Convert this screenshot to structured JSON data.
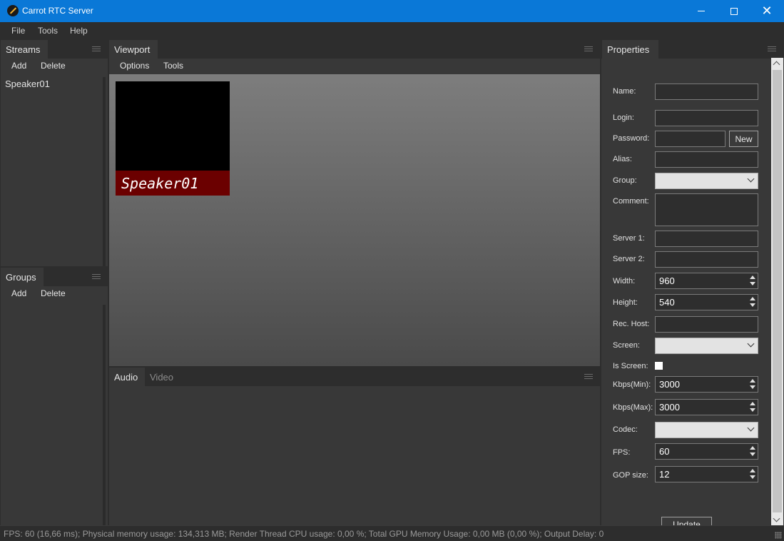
{
  "window": {
    "title": "Carrot RTC Server"
  },
  "menu": [
    "File",
    "Tools",
    "Help"
  ],
  "streams_panel": {
    "tab": "Streams",
    "toolbar": [
      "Add",
      "Delete"
    ],
    "items": [
      "Speaker01"
    ]
  },
  "groups_panel": {
    "tab": "Groups",
    "toolbar": [
      "Add",
      "Delete"
    ]
  },
  "viewport_panel": {
    "tab": "Viewport",
    "toolbar": [
      "Options",
      "Tools"
    ],
    "tile_label": "Speaker01"
  },
  "media_panel": {
    "tabs": [
      "Audio",
      "Video"
    ]
  },
  "properties": {
    "tab": "Properties",
    "new_button": "New",
    "update_button": "Update",
    "fields": {
      "name": {
        "label": "Name:",
        "value": ""
      },
      "login": {
        "label": "Login:",
        "value": ""
      },
      "password": {
        "label": "Password:",
        "value": ""
      },
      "alias": {
        "label": "Alias:",
        "value": ""
      },
      "group": {
        "label": "Group:",
        "value": ""
      },
      "comment": {
        "label": "Comment:",
        "value": ""
      },
      "server1": {
        "label": "Server 1:",
        "value": ""
      },
      "server2": {
        "label": "Server 2:",
        "value": ""
      },
      "width": {
        "label": "Width:",
        "value": "960"
      },
      "height": {
        "label": "Height:",
        "value": "540"
      },
      "rec_host": {
        "label": "Rec. Host:",
        "value": ""
      },
      "screen": {
        "label": "Screen:",
        "value": ""
      },
      "is_screen": {
        "label": "Is Screen:",
        "checked": false
      },
      "kbps_min": {
        "label": "Kbps(Min):",
        "value": "3000"
      },
      "kbps_max": {
        "label": "Kbps(Max):",
        "value": "3000"
      },
      "codec": {
        "label": "Codec:",
        "value": ""
      },
      "fps": {
        "label": "FPS:",
        "value": "60"
      },
      "gop_size": {
        "label": "GOP size:",
        "value": "12"
      }
    }
  },
  "status_bar": {
    "text": "FPS: 60 (16,66 ms); Physical memory usage: 134,313 MB; Render Thread CPU usage: 0,00 %; Total GPU Memory Usage: 0,00 MB (0,00 %); Output Delay: 0"
  },
  "colors": {
    "titlebar": "#0a78d7",
    "tile_label_bg": "#6b0000",
    "panel_bg": "#383838"
  }
}
